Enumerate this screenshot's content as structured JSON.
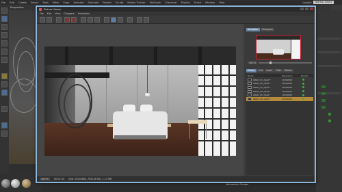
{
  "main_menu": [
    "File",
    "Edit",
    "Create",
    "Select",
    "Tools",
    "Mesh",
    "Snap",
    "Animate",
    "Simulate",
    "Render",
    "Sculpt",
    "Motion Tracker",
    "MoGraph",
    "Character",
    "Plugins",
    "Script",
    "Window",
    "Help"
  ],
  "layout": {
    "label": "Layout:",
    "value": "Startup (User)"
  },
  "viewport": {
    "label": "Perspective"
  },
  "picture_viewer": {
    "title": "Picture Viewer",
    "menu": [
      "File",
      "Edit",
      "View",
      "Compare",
      "Animation"
    ],
    "status": {
      "zoom": "100 %",
      "time": "00:01:43",
      "info": "Size: 1920x800, RGB (8 Bit), 1.13 MB"
    }
  },
  "navigator": {
    "tabs": [
      "Navigator",
      "Histogram"
    ],
    "zoom_value": "100 %"
  },
  "history": {
    "tabs": [
      "History",
      "Info",
      "Layer",
      "Filter",
      "Stereo"
    ],
    "columns": [
      "Name",
      "Resolution",
      "Render"
    ],
    "rows": [
      {
        "name": "GRAD_01_dipet *",
        "resolution": "1920x800"
      },
      {
        "name": "GRAD_02_dipet *",
        "resolution": "1920x800"
      },
      {
        "name": "GRAD_03_dipet *",
        "resolution": "1920x800"
      },
      {
        "name": "GRAD_04_dipet *",
        "resolution": "1920x800"
      },
      {
        "name": "GRAD_05_dipet *",
        "resolution": "1920x800"
      },
      {
        "name": "GRAD_06_dipet *",
        "resolution": "1920x800",
        "selected": true
      }
    ]
  },
  "bottom_label": "Volumetric Groups",
  "colors": {
    "accent": "#8ab4d8",
    "selected_row": "#b58a3a",
    "render_ok": "#3cb043"
  }
}
